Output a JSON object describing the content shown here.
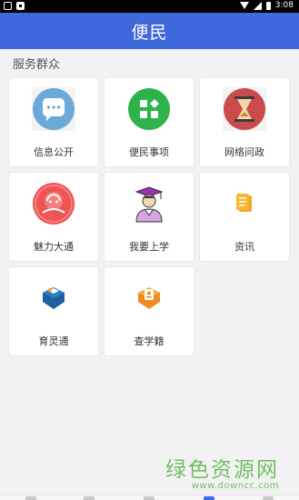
{
  "status_bar": {
    "time": "3:08",
    "icons": [
      "notification-icon",
      "app-icon",
      "wifi-icon",
      "signal-icon",
      "battery-icon"
    ]
  },
  "header": {
    "title": "便民"
  },
  "section": {
    "title": "服务群众"
  },
  "services": [
    {
      "label": "信息公开",
      "icon": "chat-bubble-icon",
      "color": "#6aa9d8"
    },
    {
      "label": "便民事项",
      "icon": "apps-grid-icon",
      "color": "#2db34a"
    },
    {
      "label": "网络问政",
      "icon": "hourglass-icon",
      "color": "#c94b4b"
    },
    {
      "label": "魅力大通",
      "icon": "landmark-icon",
      "color": "#f05454"
    },
    {
      "label": "我要上学",
      "icon": "graduate-icon",
      "color": "#9b30b8"
    },
    {
      "label": "资讯",
      "icon": "news-icon",
      "color": "#f5a623"
    },
    {
      "label": "育灵通",
      "icon": "cube-logo-icon",
      "color": "#1f5f9f"
    },
    {
      "label": "查学籍",
      "icon": "profile-badge-icon",
      "color": "#f08a24"
    }
  ],
  "watermark": {
    "text": "绿色资源网",
    "url": "www.downcc.com"
  },
  "bottom_nav": {
    "active_index": 3,
    "items": [
      "home-tab-icon",
      "folder-tab-icon",
      "camera-tab-icon",
      "people-tab-icon",
      "user-tab-icon"
    ]
  }
}
